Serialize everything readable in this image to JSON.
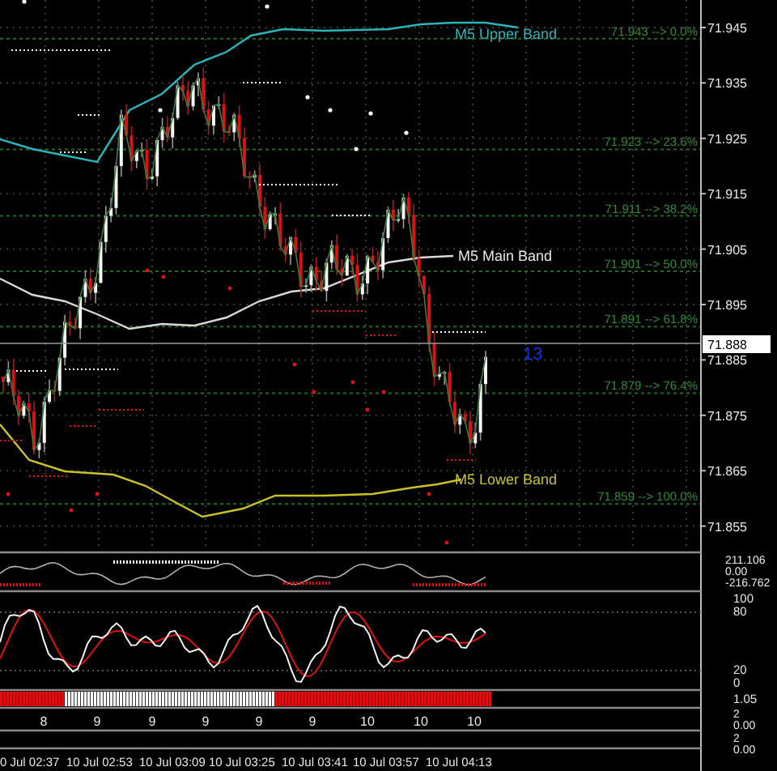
{
  "price_axis": {
    "ticks": [
      "71.945",
      "71.935",
      "71.925",
      "71.915",
      "71.905",
      "71.895",
      "71.885",
      "71.875",
      "71.865",
      "71.855"
    ],
    "current_price": "71.888"
  },
  "fib_levels": [
    {
      "label": "71.943 --> 0.0%"
    },
    {
      "label": "71.923 --> 23.6%"
    },
    {
      "label": "71.911 --> 38.2%"
    },
    {
      "label": "71.901 --> 50.0%"
    },
    {
      "label": "71.891 --> 61.8%"
    },
    {
      "label": "71.879 --> 76.4%"
    },
    {
      "label": "71.859 --> 100.0%"
    }
  ],
  "band_labels": [
    {
      "text": "M5 Upper Band",
      "color": "#2bb5b8"
    },
    {
      "text": "M5 Main Band",
      "color": "#e8e8e8"
    },
    {
      "text": "M5 Lower Band",
      "color": "#c8c22a"
    }
  ],
  "counter": "13",
  "oscillator_axis": [
    "211.106",
    "0.00",
    "-216.762"
  ],
  "stochastic_axis": [
    "100",
    "80",
    "20",
    "0"
  ],
  "signal_bar_axis": [
    "1.05"
  ],
  "period_axis": [
    "2",
    "0.00"
  ],
  "period_labels": [
    "8",
    "9",
    "9",
    "9",
    "9",
    "9",
    "10",
    "10",
    "10"
  ],
  "extra_axis": [
    "2",
    "0.00"
  ],
  "time_axis": [
    "0 Jul 02:37",
    "10 Jul 02:53",
    "10 Jul 03:09",
    "10 Jul 03:25",
    "10 Jul 03:41",
    "10 Jul 03:57",
    "10 Jul 04:13"
  ]
}
